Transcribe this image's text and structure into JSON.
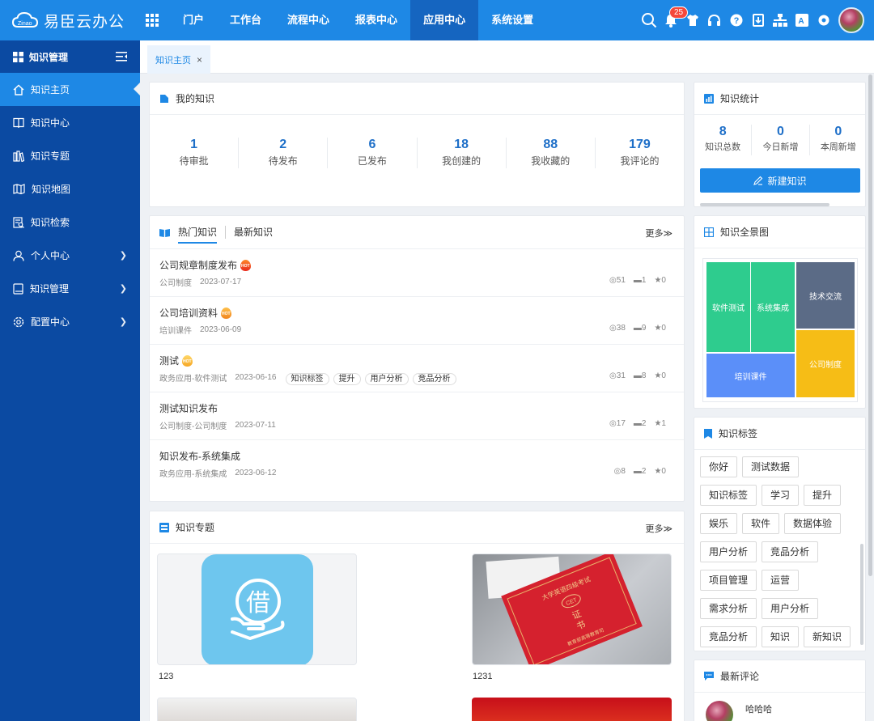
{
  "header": {
    "logo_text": "易臣云办公",
    "logo_sub": "Zinao",
    "nav": [
      "门户",
      "工作台",
      "流程中心",
      "报表中心",
      "应用中心",
      "系统设置"
    ],
    "active_nav": "应用中心",
    "notification_count": "25",
    "icons": [
      "search-icon",
      "bell-icon",
      "shirt-icon",
      "headset-icon",
      "help-icon",
      "download-icon",
      "org-chart-icon",
      "translate-icon",
      "gear-icon",
      "avatar"
    ]
  },
  "sidebar": {
    "title": "知识管理",
    "items": [
      {
        "label": "知识主页",
        "icon": "home-icon",
        "active": true,
        "has_children": false
      },
      {
        "label": "知识中心",
        "icon": "book-open-icon",
        "active": false,
        "has_children": false
      },
      {
        "label": "知识专题",
        "icon": "books-icon",
        "active": false,
        "has_children": false
      },
      {
        "label": "知识地图",
        "icon": "map-icon",
        "active": false,
        "has_children": false
      },
      {
        "label": "知识检索",
        "icon": "search-doc-icon",
        "active": false,
        "has_children": false
      },
      {
        "label": "个人中心",
        "icon": "user-icon",
        "active": false,
        "has_children": true
      },
      {
        "label": "知识管理",
        "icon": "book-icon",
        "active": false,
        "has_children": true
      },
      {
        "label": "配置中心",
        "icon": "gear-icon",
        "active": false,
        "has_children": true
      }
    ]
  },
  "tabs": {
    "home": "知识主页",
    "close": "×"
  },
  "my_knowledge": {
    "title": "我的知识",
    "stats": [
      {
        "num": "1",
        "label": "待审批"
      },
      {
        "num": "2",
        "label": "待发布"
      },
      {
        "num": "6",
        "label": "已发布"
      },
      {
        "num": "18",
        "label": "我创建的"
      },
      {
        "num": "88",
        "label": "我收藏的"
      },
      {
        "num": "179",
        "label": "我评论的"
      }
    ]
  },
  "hot_knowledge": {
    "tab_hot": "热门知识",
    "tab_new": "最新知识",
    "more": "更多≫",
    "hot_badge": "HOT",
    "items": [
      {
        "title": "公司规章制度发布",
        "badge": "red",
        "category": "公司制度",
        "date": "2023-07-17",
        "tags": [],
        "views": "◎51",
        "comments": "▬1",
        "stars": "★0"
      },
      {
        "title": "公司培训资料",
        "badge": "orange",
        "category": "培训课件",
        "date": "2023-06-09",
        "tags": [],
        "views": "◎38",
        "comments": "▬9",
        "stars": "★0"
      },
      {
        "title": "测试",
        "badge": "yellow",
        "category": "政务应用-软件测试",
        "date": "2023-06-16",
        "tags": [
          "知识标签",
          "提升",
          "用户分析",
          "竞品分析"
        ],
        "views": "◎31",
        "comments": "▬8",
        "stars": "★0"
      },
      {
        "title": "测试知识发布",
        "badge": "",
        "category": "公司制度-公司制度",
        "date": "2023-07-11",
        "tags": [],
        "views": "◎17",
        "comments": "▬2",
        "stars": "★1"
      },
      {
        "title": "知识发布-系统集成",
        "badge": "",
        "category": "政务应用-系统集成",
        "date": "2023-06-12",
        "tags": [],
        "views": "◎8",
        "comments": "▬2",
        "stars": "★0"
      }
    ]
  },
  "topics": {
    "title": "知识专题",
    "more": "更多≫",
    "items": [
      {
        "label": "123",
        "glyph": "借"
      },
      {
        "label": "1231",
        "cert_title": "大学英语四级考试",
        "cert_logo": "CET",
        "cert_word1": "证",
        "cert_word2": "书",
        "cert_sub": "教育部高等教育司"
      }
    ]
  },
  "knowledge_stats": {
    "title": "知识统计",
    "items": [
      {
        "num": "8",
        "label": "知识总数"
      },
      {
        "num": "0",
        "label": "今日新增"
      },
      {
        "num": "0",
        "label": "本周新增"
      }
    ],
    "new_button": "新建知识"
  },
  "knowledge_map": {
    "title": "知识全景图",
    "blocks": [
      {
        "label": "软件测试",
        "color": "#2ecc8e"
      },
      {
        "label": "系统集成",
        "color": "#2ecc8e"
      },
      {
        "label": "技术交流",
        "color": "#5b6b86"
      },
      {
        "label": "培训课件",
        "color": "#5b8ff9"
      },
      {
        "label": "公司制度",
        "color": "#f6bd16"
      }
    ]
  },
  "knowledge_tags": {
    "title": "知识标签",
    "tags": [
      "你好",
      "测试数据",
      "知识标签",
      "学习",
      "提升",
      "娱乐",
      "软件",
      "数据体验",
      "用户分析",
      "竞品分析",
      "项目管理",
      "运营",
      "需求分析",
      "用户分析",
      "竞品分析",
      "知识",
      "新知识"
    ]
  },
  "comments": {
    "title": "最新评论",
    "user": "哈哈哈"
  },
  "colors": {
    "primary": "#1e88e5",
    "sidebar": "#0b4aa2",
    "active_nav": "#1565c0"
  }
}
